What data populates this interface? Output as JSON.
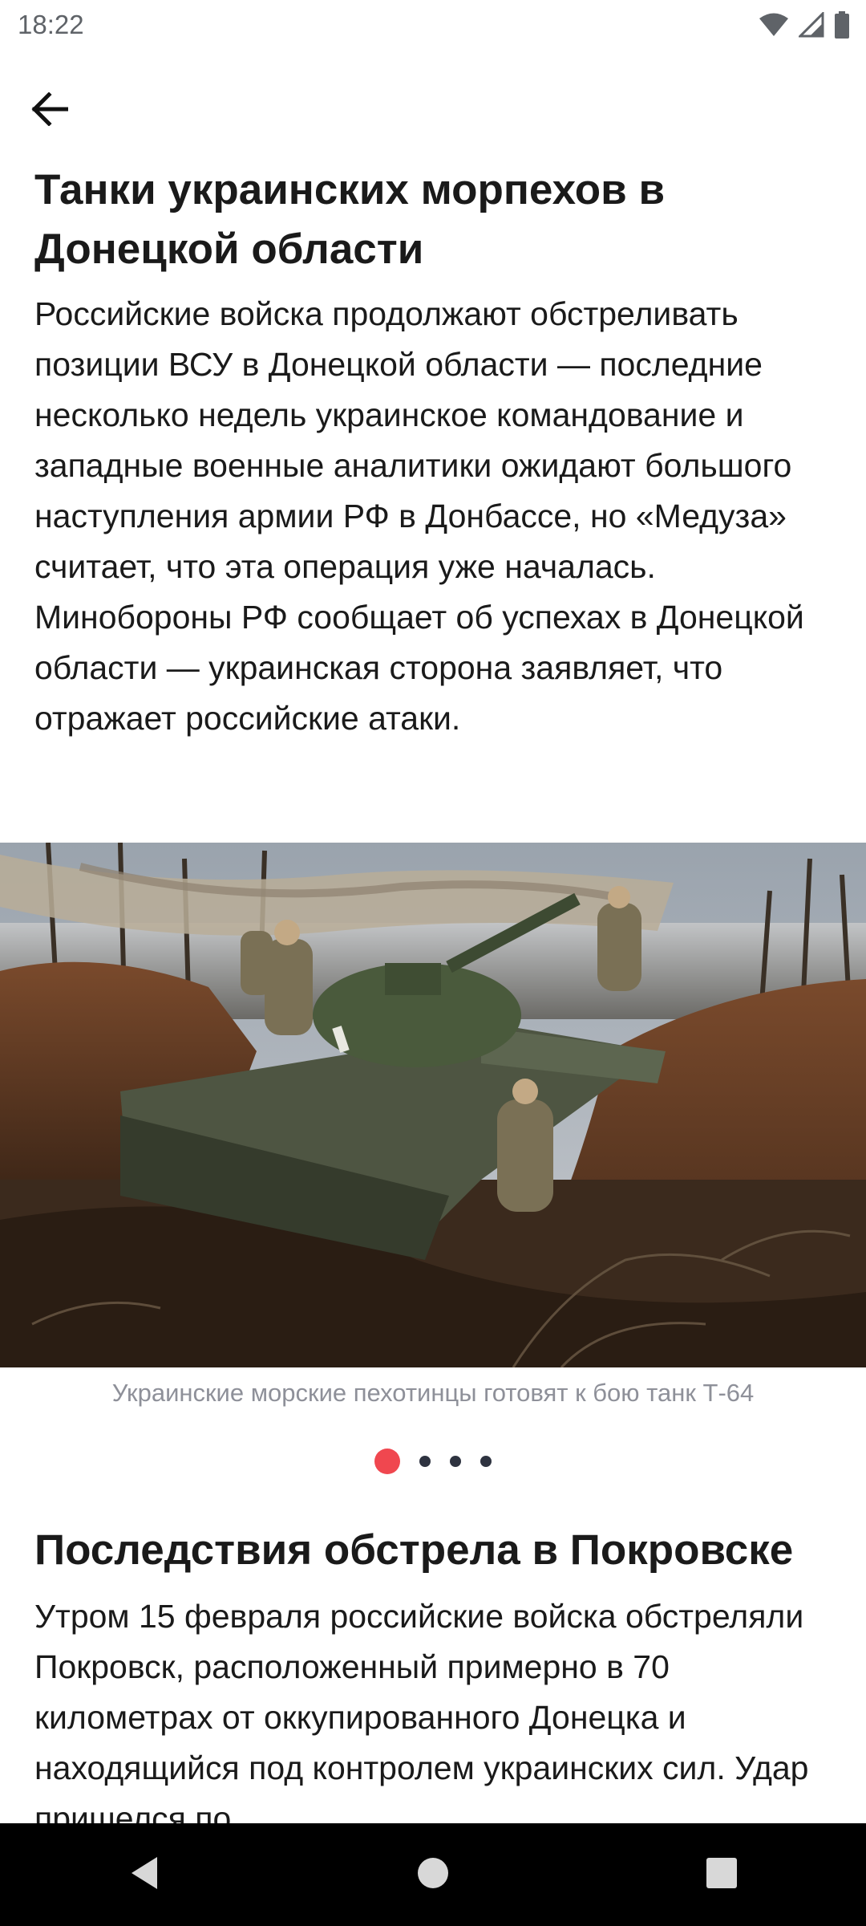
{
  "status_bar": {
    "time": "18:22",
    "icons": [
      "wifi-icon",
      "signal-icon",
      "battery-icon"
    ]
  },
  "toolbar": {
    "back_icon": "arrow-left-icon"
  },
  "sections": [
    {
      "title": "Танки украинских морпехов в Донецкой области",
      "body": "Российские войска продолжают обстреливать позиции ВСУ в Донецкой области — последние несколько недель украинское командование и западные военные аналитики ожидают большого наступления армии РФ в Донбассе, но «Медуза» считает, что эта операция уже началась. Минобороны РФ сообщает об успехах в Донецкой области — украинская сторона заявляет, что отражает российские атаки."
    },
    {
      "title": "Последствия обстрела в Покровске",
      "body": "Утром 15 февраля российские войска обстреляли Покровск, расположенный примерно в 70 километрах от оккупированного Донецка и находящийся под контролем украинских сил. Удар пришелся по"
    }
  ],
  "gallery": {
    "caption": "Украинские морские пехотинцы готовят к бою танк Т-64",
    "total": 4,
    "active_index": 0
  },
  "nav_bar": {
    "icons": [
      "back-triangle-icon",
      "home-circle-icon",
      "recents-square-icon"
    ]
  },
  "colors": {
    "accent": "#f0474f",
    "caption": "#8e9099",
    "text": "#1a1a1a"
  }
}
